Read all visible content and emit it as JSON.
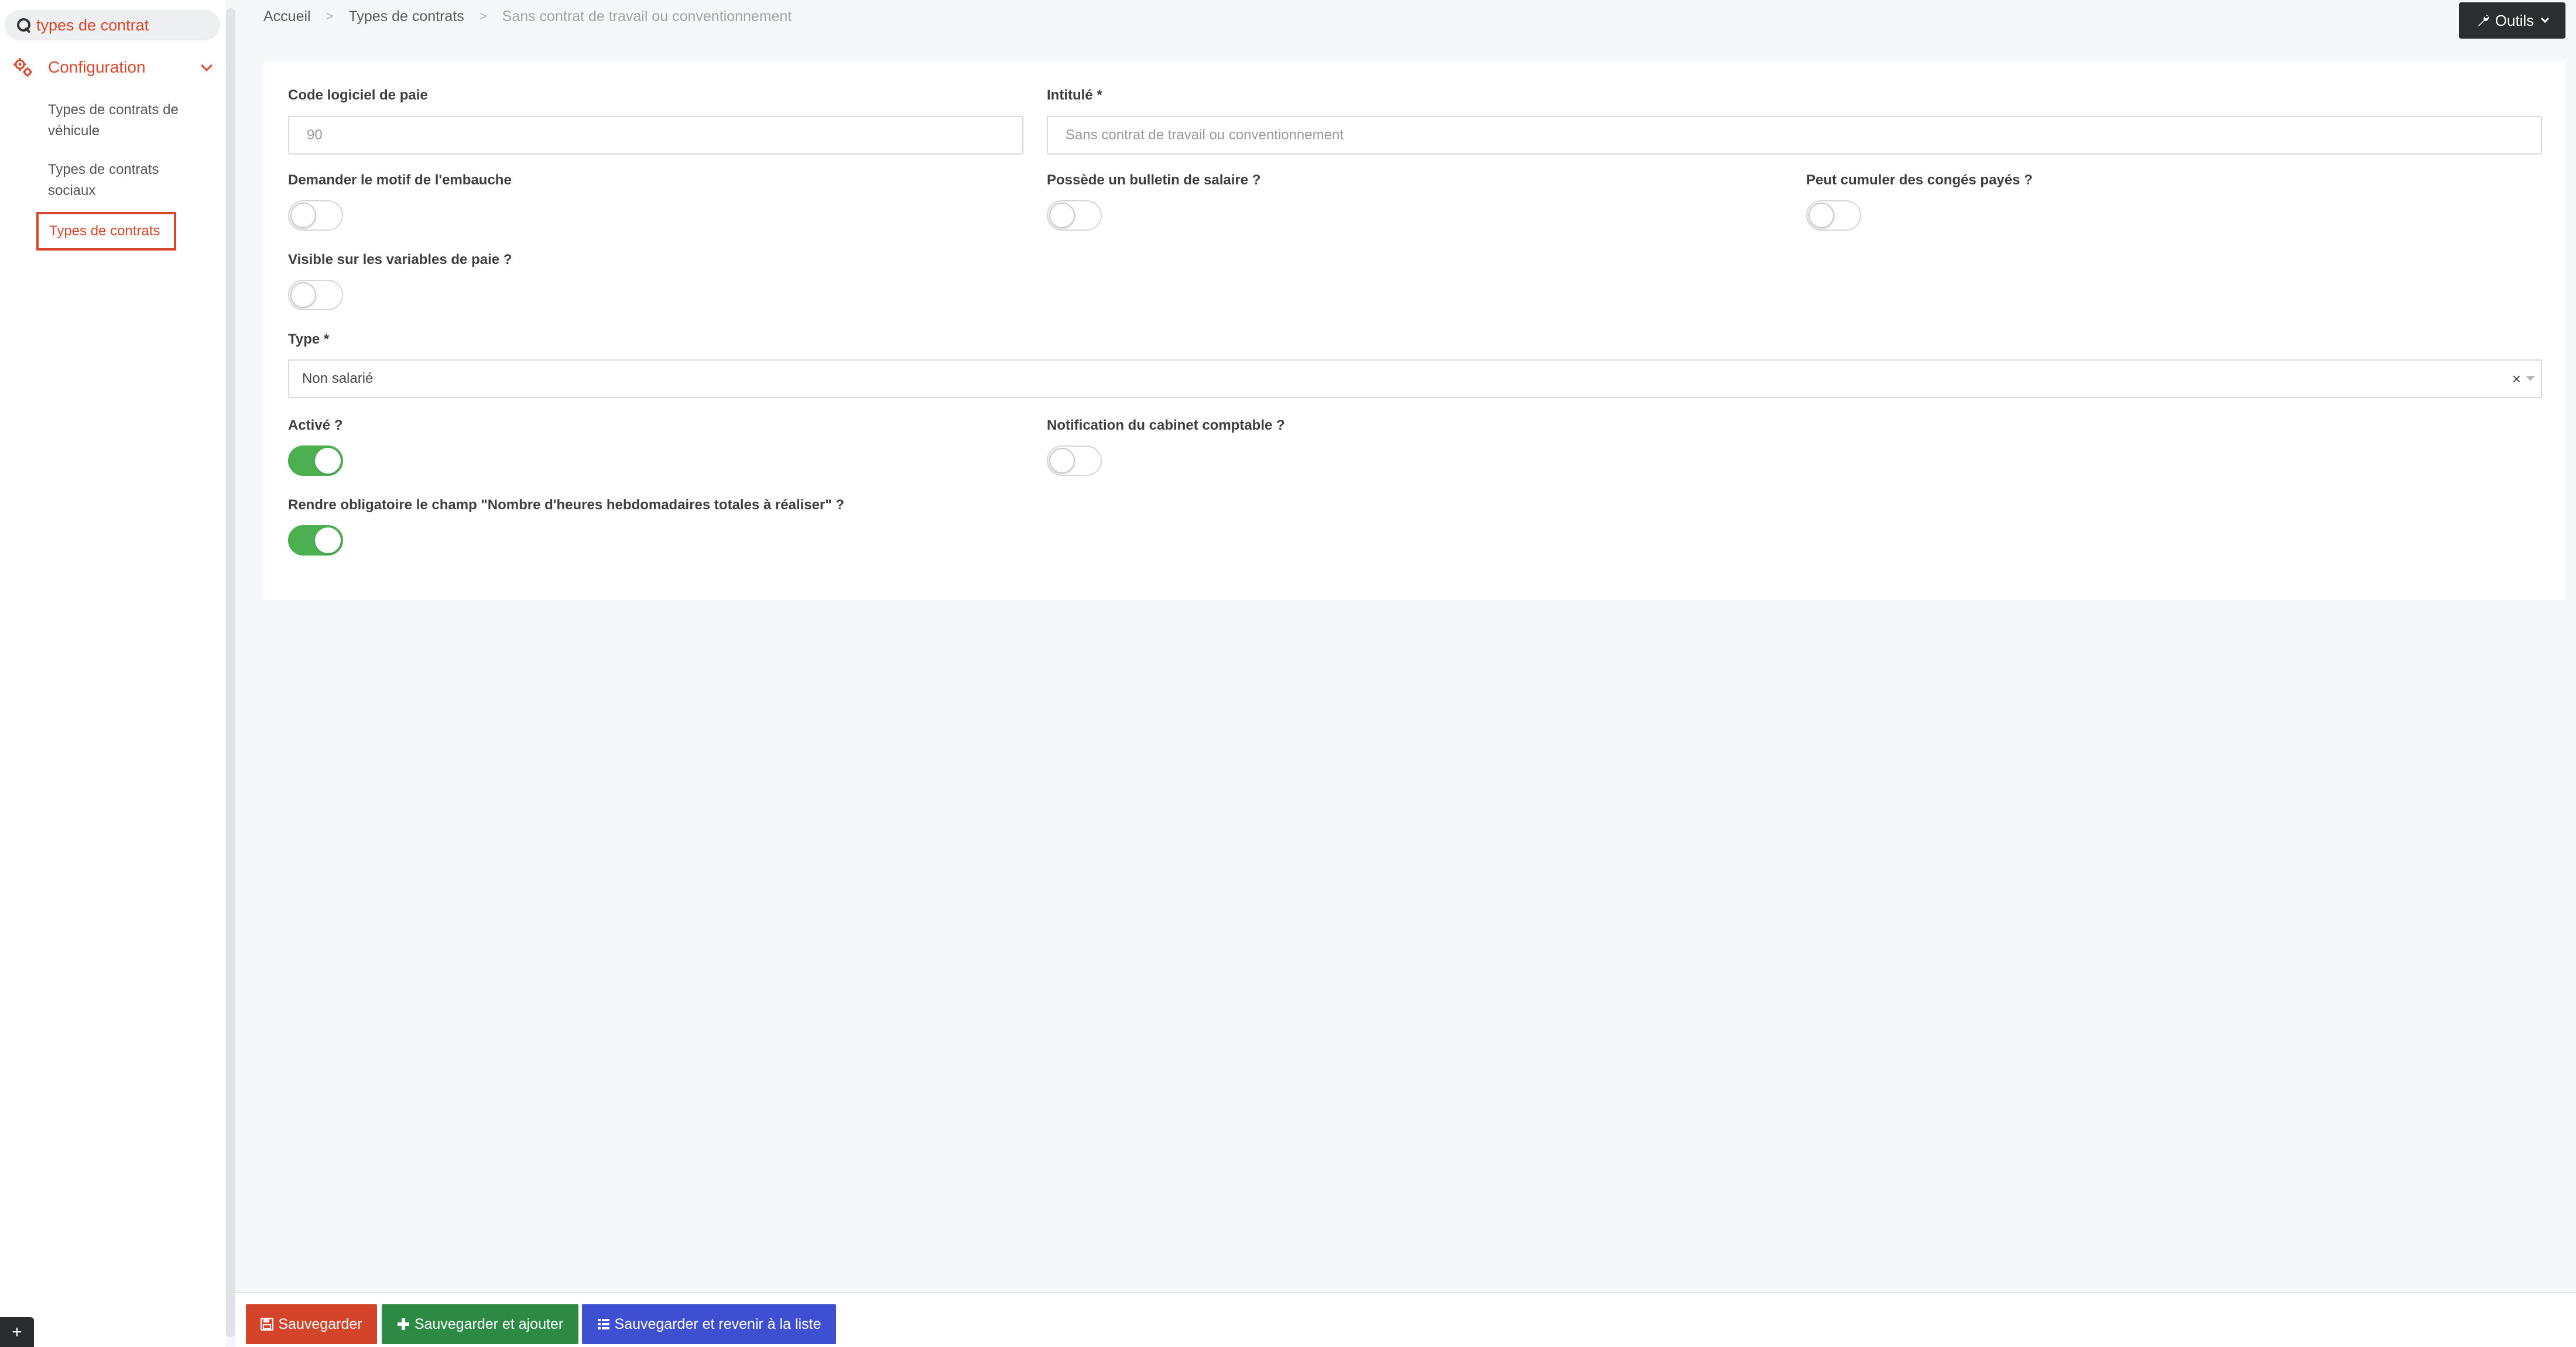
{
  "sidebar": {
    "search": {
      "value": "types de contrat"
    },
    "menu": {
      "label": "Configuration"
    },
    "items": [
      {
        "label": "Types de contrats de véhicule"
      },
      {
        "label": "Types de contrats sociaux"
      },
      {
        "label": "Types de contrats"
      }
    ],
    "plus_label": "+"
  },
  "breadcrumb": {
    "items": [
      "Accueil",
      "Types de contrats",
      "Sans contrat de travail ou conventionnement"
    ],
    "separator": ">"
  },
  "toolbar": {
    "tools_label": "Outils"
  },
  "form": {
    "code": {
      "label": "Code logiciel de paie",
      "value": "90"
    },
    "title": {
      "label": "Intitulé *",
      "value": "Sans contrat de travail ou conventionnement"
    },
    "ask_reason": {
      "label": "Demander le motif de l'embauche",
      "on": false
    },
    "has_payslip": {
      "label": "Possède un bulletin de salaire ?",
      "on": false
    },
    "cumulate_leave": {
      "label": "Peut cumuler des congés payés ?",
      "on": false
    },
    "visible_vars": {
      "label": "Visible sur les variables de paie ?",
      "on": false
    },
    "type": {
      "label": "Type *",
      "value": "Non salarié",
      "clear_symbol": "×"
    },
    "active": {
      "label": "Activé ?",
      "on": true
    },
    "notify_accounting": {
      "label": "Notification du cabinet comptable ?",
      "on": false
    },
    "require_hours": {
      "label": "Rendre obligatoire le champ \"Nombre d'heures hebdomadaires totales à réaliser\" ?",
      "on": true
    }
  },
  "actions": {
    "save": "Sauvegarder",
    "save_add": "Sauvegarder et ajouter",
    "save_list": "Sauvegarder et revenir à la liste"
  },
  "colors": {
    "accent": "#d9472b",
    "toggle_on": "#4caf50",
    "save": "#d3442a",
    "save_add": "#2d8a45",
    "save_list": "#3f4fd1",
    "dark_button": "#2b2d31"
  }
}
